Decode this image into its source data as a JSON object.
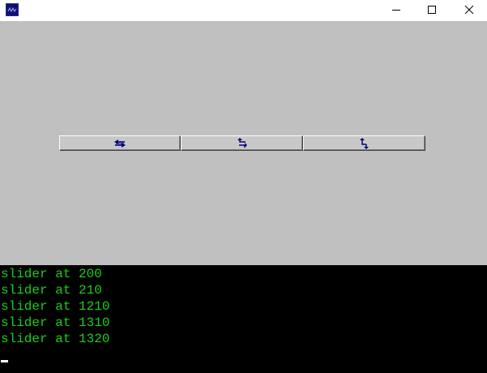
{
  "window": {
    "icon": "app-icon",
    "controls": [
      {
        "name": "minimize-icon"
      },
      {
        "name": "maximize-icon"
      },
      {
        "name": "close-icon"
      }
    ]
  },
  "toolbar": {
    "buttons": [
      {
        "icon": "double-arrow-icon"
      },
      {
        "icon": "swap-arrows-icon"
      },
      {
        "icon": "down-up-arrows-icon"
      }
    ],
    "icon_color": "#000080",
    "face_color": "#c8c8c8"
  },
  "console": {
    "text_color": "#18d018",
    "background": "#000000",
    "lines": [
      "slider at 200",
      "slider at 210",
      "slider at 1210",
      "slider at 1310",
      "slider at 1320"
    ]
  },
  "colors": {
    "client_bg": "#c0c0c0",
    "titlebar_bg": "#ffffff"
  }
}
